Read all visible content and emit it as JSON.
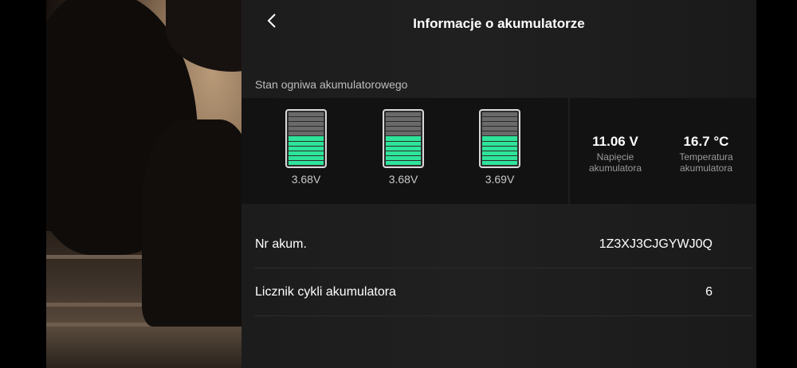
{
  "header": {
    "back_icon": "chevron-left-icon",
    "title": "Informacje o akumulatorze"
  },
  "cells_section": {
    "label": "Stan ogniwa akumulatorowego",
    "cells": [
      {
        "voltage": "3.68V",
        "filled_segments": 6,
        "total_segments": 11
      },
      {
        "voltage": "3.68V",
        "filled_segments": 6,
        "total_segments": 11
      },
      {
        "voltage": "3.69V",
        "filled_segments": 6,
        "total_segments": 11
      }
    ]
  },
  "stats": {
    "voltage": {
      "value": "11.06 V",
      "label_line1": "Napięcie",
      "label_line2": "akumulatora"
    },
    "temperature": {
      "value": "16.7 °C",
      "label_line1": "Temperatura",
      "label_line2": "akumulatora"
    }
  },
  "info_rows": [
    {
      "label": "Nr akum.",
      "value": "1Z3XJ3CJGYWJ0Q"
    },
    {
      "label": "Licznik cykli akumulatora",
      "value": "6"
    }
  ],
  "colors": {
    "cell_fill": "#2ee49a",
    "cell_empty": "#6a6a6a",
    "panel_bg": "#1c1c1c"
  }
}
